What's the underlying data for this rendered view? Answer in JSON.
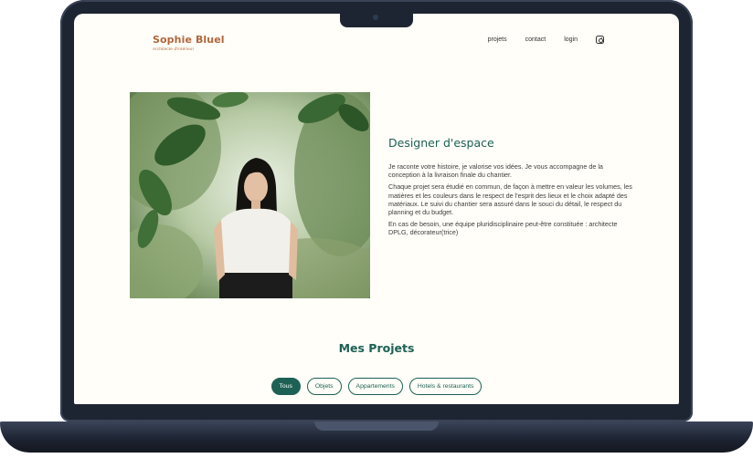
{
  "header": {
    "brand_name": "Sophie Bluel",
    "brand_subtitle": "Architecte d'intérieur",
    "nav": {
      "projets": "projets",
      "contact": "contact",
      "login": "login"
    },
    "instagram_icon": "instagram-icon"
  },
  "intro": {
    "title": "Designer d'espace",
    "paragraphs": [
      "Je raconte votre histoire, je valorise vos idées. Je vous accompagne de la conception à la livraison finale du chantier.",
      "Chaque projet sera étudié en commun, de façon à mettre en valeur les volumes, les matières et les couleurs dans le respect de l'esprit des lieux et le choix adapté des matériaux. Le suivi du chantier sera assuré dans le souci du détail, le respect du planning et du budget.",
      "En cas de besoin, une équipe pluridisciplinaire peut-être constituée : architecte DPLG, décorateur(trice)"
    ]
  },
  "projects": {
    "title": "Mes Projets",
    "filters": [
      "Tous",
      "Objets",
      "Appartements",
      "Hotels & restaurants"
    ],
    "active_filter": "Tous"
  },
  "colors": {
    "accent": "#1d6154",
    "brand": "#b1663c",
    "background": "#fffef8",
    "laptop": "#1e2532"
  }
}
